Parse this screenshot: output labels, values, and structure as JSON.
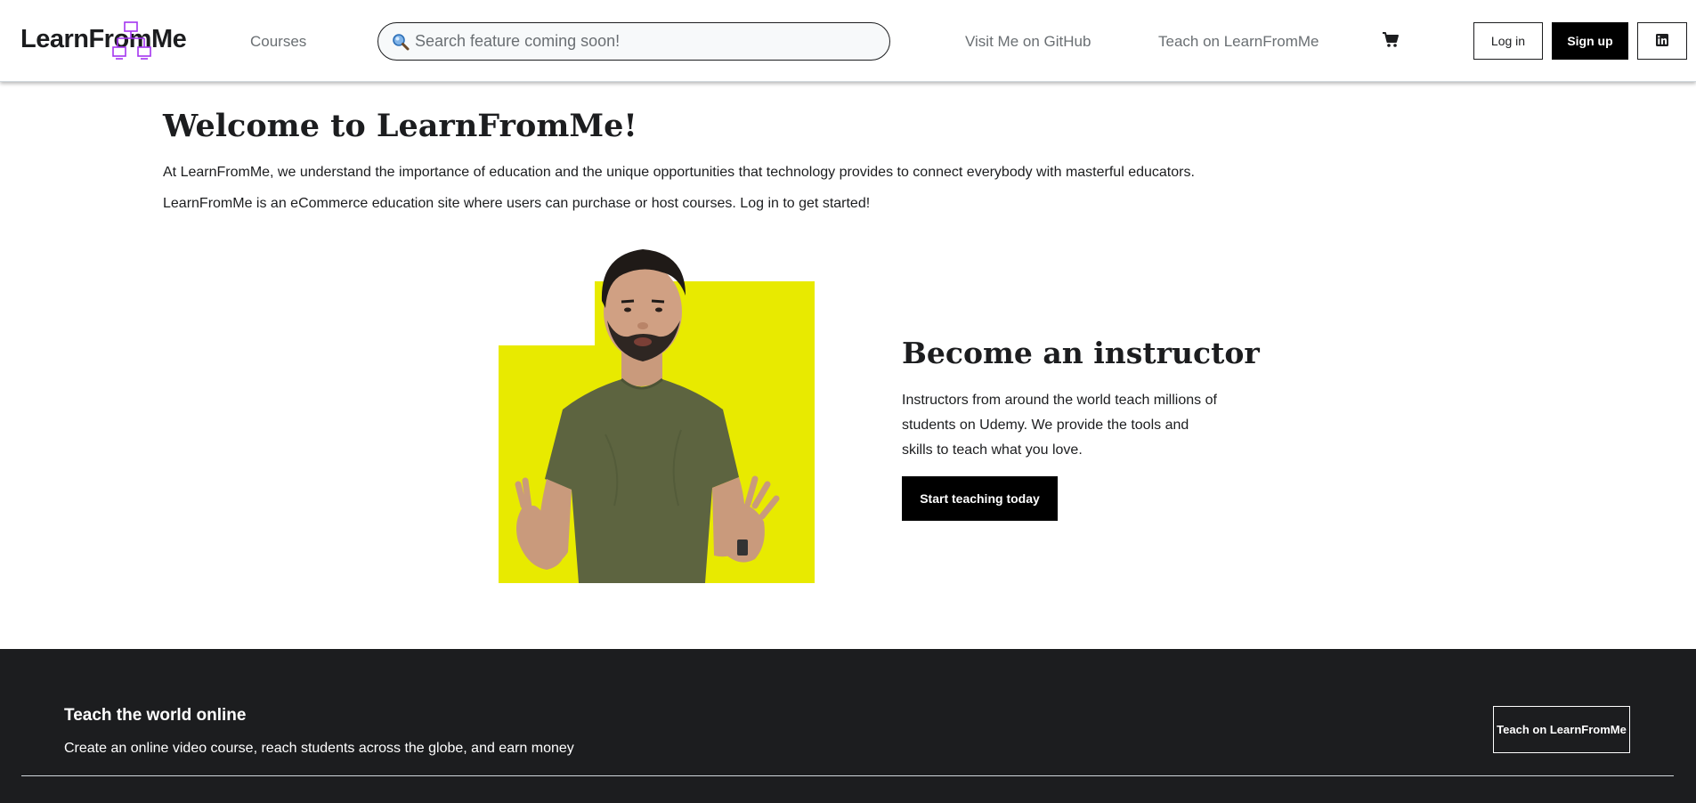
{
  "header": {
    "logo_text": "LearnFromMe",
    "nav_courses": "Courses",
    "search_placeholder": "Search feature coming soon!",
    "nav_github": "Visit Me on GitHub",
    "nav_teach": "Teach on LearnFromMe",
    "cart_icon": "cart-icon",
    "login_label": "Log in",
    "signup_label": "Sign up",
    "linkedin_icon": "linkedin-icon"
  },
  "main": {
    "title": "Welcome to LearnFromMe!",
    "paragraph1": "At LearnFromMe, we understand the importance of education and the unique opportunities that technology provides to connect everybody with masterful educators.",
    "paragraph2": "LearnFromMe is an eCommerce education site where users can purchase or host courses. Log in to get started!",
    "instructor_title": "Become an instructor",
    "instructor_description": "Instructors from around the world teach millions of students on Udemy. We provide the tools and skills to teach what you love.",
    "start_button_label": "Start teaching today"
  },
  "footer": {
    "title": "Teach the world online",
    "subtitle": "Create an online video course, reach students across the globe, and earn money",
    "button_label": "Teach on LearnFromMe"
  },
  "colors": {
    "accent_purple": "#a435f0",
    "hero_yellow": "#e8ea00",
    "shirt_green": "#5d6440",
    "footer_bg": "#1c1d1f"
  }
}
